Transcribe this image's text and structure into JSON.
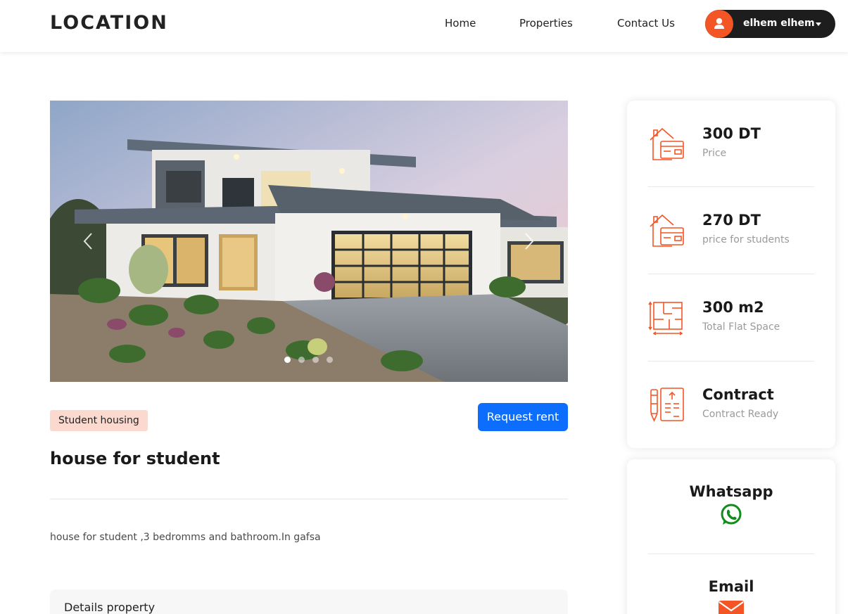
{
  "header": {
    "brand": "LOCATION",
    "nav": [
      "Home",
      "Properties",
      "Contact Us"
    ],
    "user_name": "elhem elhem"
  },
  "carousel": {
    "slide_count": 4,
    "active_index": 0
  },
  "listing": {
    "tag": "Student housing",
    "request_label": "Request rent",
    "title": "house for student",
    "description": "house for student ,3 bedromms and bathroom.In gafsa",
    "details_title": "Details property"
  },
  "info": [
    {
      "value": "300 DT",
      "label": "Price",
      "icon": "house-price-icon"
    },
    {
      "value": "270 DT",
      "label": "price for students",
      "icon": "house-price-icon"
    },
    {
      "value": "300 m2",
      "label": "Total Flat Space",
      "icon": "floor-plan-icon"
    },
    {
      "value": "Contract",
      "label": "Contract Ready",
      "icon": "contract-icon"
    }
  ],
  "contact": {
    "whatsapp": "Whatsapp",
    "email": "Email"
  },
  "colors": {
    "accent": "#f35525",
    "primary_button": "#0d6efd",
    "whatsapp": "#128c1e",
    "dark": "#1d1d1d"
  }
}
